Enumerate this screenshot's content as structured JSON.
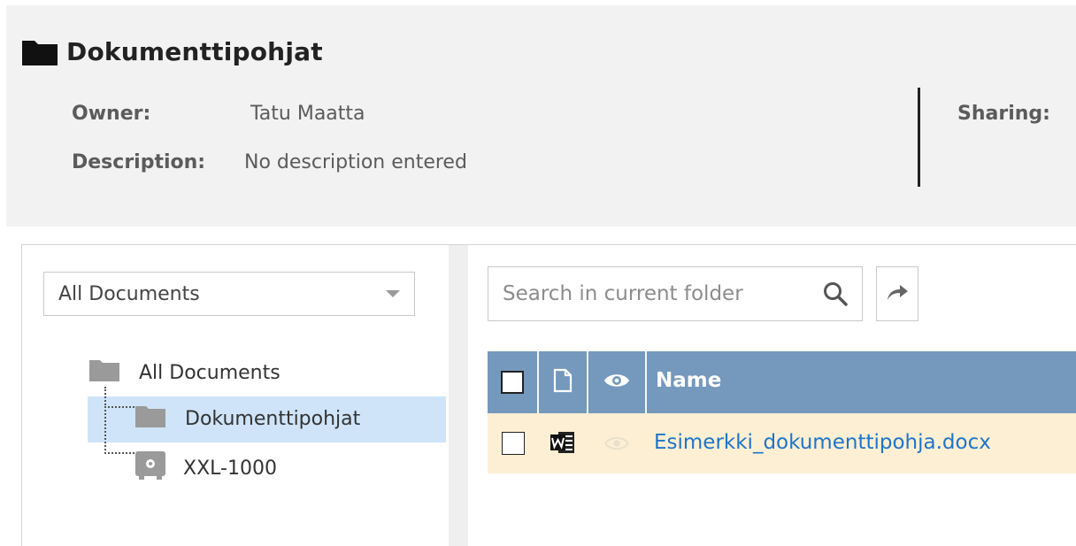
{
  "header": {
    "title": "Dokumenttipohjat",
    "owner_label": "Owner:",
    "owner_value": "Tatu Maatta",
    "description_label": "Description:",
    "description_value": "No description entered",
    "sharing_label": "Sharing:"
  },
  "sidebar": {
    "scope_select": "All Documents",
    "tree": [
      {
        "label": "All Documents",
        "icon": "folder-icon"
      },
      {
        "label": "Dokumenttipohjat",
        "icon": "folder-icon",
        "selected": true
      },
      {
        "label": "XXL-1000",
        "icon": "safe-icon"
      }
    ]
  },
  "toolbar": {
    "search_placeholder": "Search in current folder"
  },
  "table": {
    "columns": [
      {
        "key": "select",
        "icon": "checkbox"
      },
      {
        "key": "type",
        "icon": "file-icon"
      },
      {
        "key": "view",
        "icon": "eye-icon"
      },
      {
        "key": "name",
        "label": "Name"
      }
    ],
    "rows": [
      {
        "name": "Esimerkki_dokumenttipohja.docx",
        "type_icon": "word-icon"
      }
    ]
  },
  "colors": {
    "header_bg": "#f2f2f2",
    "table_header": "#7598bd",
    "row_highlight": "#fcefd3",
    "tree_selected": "#cfe4f8",
    "link": "#1f74c9"
  }
}
